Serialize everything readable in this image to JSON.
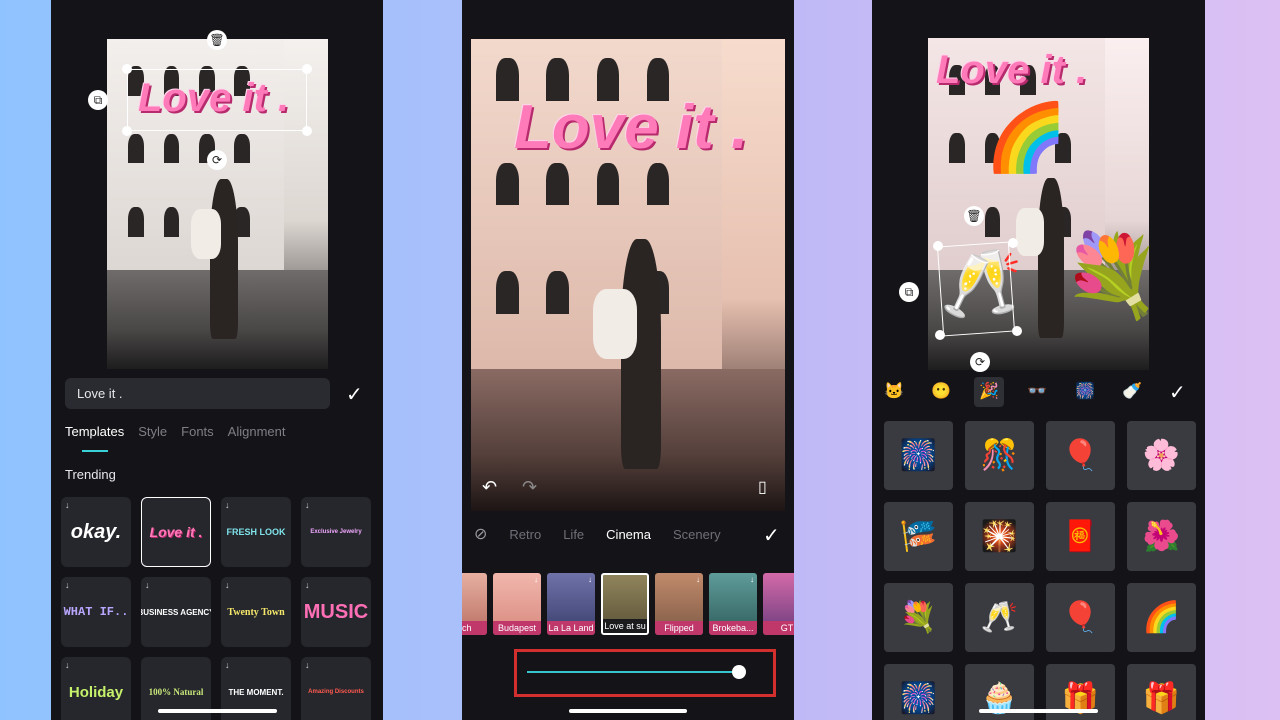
{
  "screen1": {
    "text_value": "Love it .",
    "overlay_text": "Love it .",
    "tabs": [
      {
        "label": "Templates"
      },
      {
        "label": "Style"
      },
      {
        "label": "Fonts"
      },
      {
        "label": "Alignment"
      }
    ],
    "section_title": "Trending",
    "templates": [
      {
        "label": "okay.",
        "color": "#ffffff"
      },
      {
        "label": "Love it .",
        "color": "#ff7ab8"
      },
      {
        "label": "FRESH LOOK",
        "color": "#7fe3ea"
      },
      {
        "label": "Exclusive Jewelry",
        "color": "#f0a8ff"
      },
      {
        "label": "WHAT IF..",
        "color": "#b9a6ff"
      },
      {
        "label": "BUSINESS AGENCY",
        "color": "#ffffff"
      },
      {
        "label": "Twenty Town",
        "color": "#f5e86a"
      },
      {
        "label": "MUSIC",
        "color": "#ff6fb6"
      },
      {
        "label": "Holiday",
        "color": "#c6f26b"
      },
      {
        "label": "100% Natural",
        "color": "#c9e87a"
      },
      {
        "label": "THE MOMENT.",
        "color": "#ffffff"
      },
      {
        "label": "Amazing Discounts",
        "color": "#ff5a4e"
      }
    ]
  },
  "screen2": {
    "overlay_text": "Love it .",
    "categories": [
      {
        "label": "Retro",
        "active": false
      },
      {
        "label": "Life",
        "active": false
      },
      {
        "label": "Cinema",
        "active": true
      },
      {
        "label": "Scenery",
        "active": false
      }
    ],
    "filters": [
      {
        "label": "atch",
        "tone": "#b96f63"
      },
      {
        "label": "Budapest",
        "tone": "#d8897e"
      },
      {
        "label": "La La Land",
        "tone": "#3a3f6e"
      },
      {
        "label": "Love at su",
        "tone": "#5c5338"
      },
      {
        "label": "Flipped",
        "tone": "#7f5a45"
      },
      {
        "label": "Brokeba...",
        "tone": "#2f5e5c"
      },
      {
        "label": "GT",
        "tone": "#6a3c7e"
      }
    ],
    "intensity": 1.0
  },
  "screen3": {
    "overlay_text": "Love it .",
    "categories": [
      {
        "icon": "🐱"
      },
      {
        "icon": "😶"
      },
      {
        "icon": "🎉"
      },
      {
        "icon": "👓"
      },
      {
        "icon": "🎆"
      },
      {
        "icon": "🍼"
      }
    ],
    "stickers": [
      {
        "icon": "🎆"
      },
      {
        "icon": "🎊"
      },
      {
        "icon": "🎈"
      },
      {
        "icon": "🌸"
      },
      {
        "icon": "🎏"
      },
      {
        "icon": "🎇"
      },
      {
        "icon": "🧧"
      },
      {
        "icon": "🌺"
      },
      {
        "icon": "💐"
      },
      {
        "icon": "🥂"
      },
      {
        "icon": "🎈"
      },
      {
        "icon": "🌈"
      },
      {
        "icon": "🎆"
      },
      {
        "icon": "🧁"
      },
      {
        "icon": "🎁"
      },
      {
        "icon": "🎁"
      }
    ]
  }
}
